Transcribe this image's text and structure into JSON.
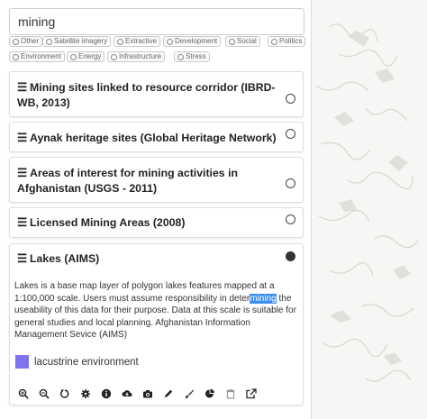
{
  "search": {
    "value": "mining"
  },
  "tags": [
    "Other",
    "Satellite imagery",
    "Extractive",
    "Development",
    "Social",
    "Politics",
    "Environment",
    "Energy",
    "Infrastructure",
    "Stress"
  ],
  "layers": [
    {
      "title": "Mining sites linked to resource corridor (IBRD-WB, 2013)",
      "selected": false
    },
    {
      "title": "Aynak heritage sites (Global Heritage Network)",
      "selected": false
    },
    {
      "title": "Areas of interest for mining activities in Afghanistan (USGS - 2011)",
      "selected": false
    },
    {
      "title": "Licensed Mining Areas (2008)",
      "selected": false
    },
    {
      "title": "Lakes (AIMS)",
      "selected": true
    }
  ],
  "active_layer": {
    "description_before": "Lakes is a base map layer of polygon lakes features mapped at a 1:100,000 scale. Users must assume responsibility in deter",
    "description_highlight": "mining",
    "description_after": " the useability of this data for their purpose. Data at this scale is suitable for general studies and local planning. Afghanistan Information Management Sevice (AIMS)",
    "legend_label": "lacustrine environment",
    "legend_color": "#7f73f0"
  },
  "toolbar": {
    "icons": [
      "zoom-in-icon",
      "zoom-to-layer-icon",
      "reset-icon",
      "settings-icon",
      "info-icon",
      "download-icon",
      "camera-icon",
      "edit-icon",
      "style-brush-icon",
      "chart-icon",
      "delete-icon",
      "external-link-icon"
    ]
  },
  "colors": {
    "accent_highlight": "#3d8ef0",
    "map_background": "#f6f6f4"
  }
}
